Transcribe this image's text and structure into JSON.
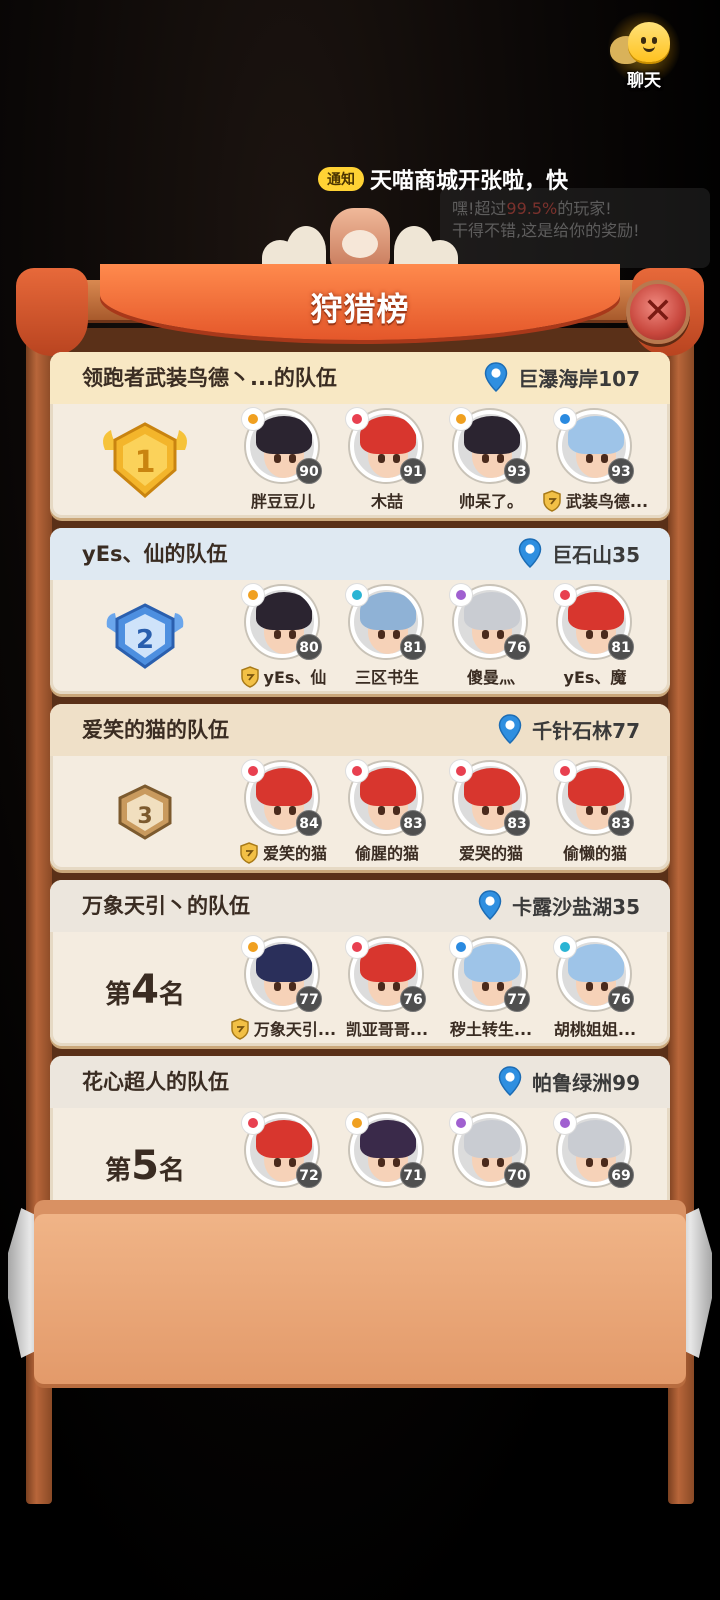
{
  "screen": {
    "title": "狩猎榜"
  },
  "chat": {
    "label": "聊天"
  },
  "notice": {
    "tag": "通知",
    "text": "天喵商城开张啦，快"
  },
  "background_popup": {
    "line1_prefix": "嘿!超过",
    "line1_highlight": "99.5%",
    "line1_suffix": "的玩家!",
    "line2": "干得不错,这是给你的奖励!"
  },
  "colors": {
    "accent_orange": "#e4572a",
    "card_bg": "#f4ece0",
    "gold": "#f3b52b",
    "silver_blue": "#4d8fe0",
    "bronze": "#c99a5e",
    "level_badge": "#4f4f4f"
  },
  "teams": [
    {
      "rank": 1,
      "rank_badge": "gold-badge-icon",
      "header_color": "#f8e8c4",
      "team_name": "领跑者武装鸟德丶...的队伍",
      "location": "巨瀑海岸107",
      "members": [
        {
          "name": "胖豆豆儿",
          "level": "90",
          "element": "fire",
          "hair": "#2b2430",
          "leader": false
        },
        {
          "name": "木喆",
          "level": "91",
          "element": "wind",
          "hair": "#d8362e",
          "leader": false
        },
        {
          "name": "帅呆了。",
          "level": "93",
          "element": "fire",
          "hair": "#2b2430",
          "leader": false
        },
        {
          "name": "武装鸟德...",
          "level": "93",
          "element": "water",
          "hair": "#9ec4e8",
          "leader": true
        }
      ]
    },
    {
      "rank": 2,
      "rank_badge": "silver-badge-icon",
      "header_color": "#dfe9f2",
      "team_name": "yEs、仙的队伍",
      "location": "巨石山35",
      "members": [
        {
          "name": "yEs、仙",
          "level": "80",
          "element": "fire",
          "hair": "#2b2430",
          "leader": true
        },
        {
          "name": "三区书生",
          "level": "81",
          "element": "ice",
          "hair": "#8fb2d6",
          "leader": false
        },
        {
          "name": "傻曼灬",
          "level": "76",
          "element": "dark",
          "hair": "#c9ccd2",
          "leader": false
        },
        {
          "name": "yEs、魔",
          "level": "81",
          "element": "wind",
          "hair": "#d8362e",
          "leader": false
        }
      ]
    },
    {
      "rank": 3,
      "rank_badge": "bronze-badge-icon",
      "header_color": "#efe0c8",
      "team_name": "爱笑的猫的队伍",
      "location": "千针石林77",
      "members": [
        {
          "name": "爱笑的猫",
          "level": "84",
          "element": "wind",
          "hair": "#d8362e",
          "leader": true
        },
        {
          "name": "偷腥的猫",
          "level": "83",
          "element": "wind",
          "hair": "#d8362e",
          "leader": false
        },
        {
          "name": "爱哭的猫",
          "level": "83",
          "element": "wind",
          "hair": "#d8362e",
          "leader": false
        },
        {
          "name": "偷懒的猫",
          "level": "83",
          "element": "wind",
          "hair": "#d8362e",
          "leader": false
        }
      ]
    },
    {
      "rank": 4,
      "rank_prefix": "第",
      "rank_number": "4",
      "rank_suffix": "名",
      "header_color": "#ece6dd",
      "team_name": "万象天引丶的队伍",
      "location": "卡露沙盐湖35",
      "members": [
        {
          "name": "万象天引...",
          "level": "77",
          "element": "fire",
          "hair": "#2a2f5a",
          "leader": true
        },
        {
          "name": "凯亚哥哥...",
          "level": "76",
          "element": "wind",
          "hair": "#d8362e",
          "leader": false
        },
        {
          "name": "秽土转生...",
          "level": "77",
          "element": "water",
          "hair": "#9ec4e8",
          "leader": false
        },
        {
          "name": "胡桃姐姐...",
          "level": "76",
          "element": "ice",
          "hair": "#9ec4e8",
          "leader": false
        }
      ]
    },
    {
      "rank": 5,
      "rank_prefix": "第",
      "rank_number": "5",
      "rank_suffix": "名",
      "header_color": "#ece6dd",
      "team_name": "花心超人的队伍",
      "location": "帕鲁绿洲99",
      "members": [
        {
          "name": "",
          "level": "72",
          "element": "wind",
          "hair": "#d8362e",
          "leader": false
        },
        {
          "name": "",
          "level": "71",
          "element": "fire",
          "hair": "#3a2a4a",
          "leader": false
        },
        {
          "name": "",
          "level": "70",
          "element": "dark",
          "hair": "#c9ccd2",
          "leader": false
        },
        {
          "name": "",
          "level": "69",
          "element": "dark",
          "hair": "#c9ccd2",
          "leader": false
        }
      ]
    }
  ]
}
